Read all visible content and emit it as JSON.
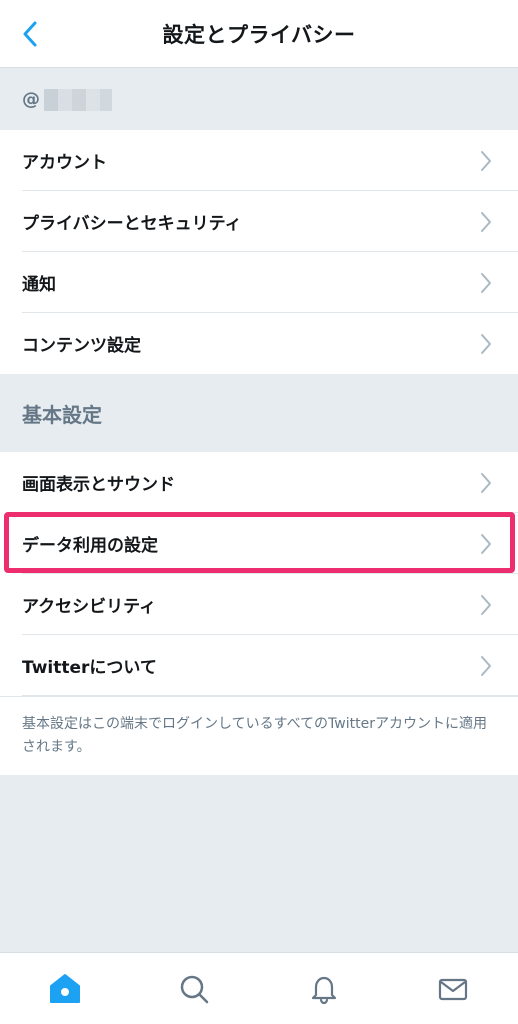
{
  "header": {
    "title": "設定とプライバシー",
    "back_icon": "back-chevron-icon"
  },
  "account": {
    "handle_prefix": "@"
  },
  "accent_color": "#1da1f2",
  "highlight_color": "#ec2e6e",
  "account_items": [
    {
      "label": "アカウント"
    },
    {
      "label": "プライバシーとセキュリティ"
    },
    {
      "label": "通知"
    },
    {
      "label": "コンテンツ設定"
    }
  ],
  "general": {
    "title": "基本設定",
    "items": [
      {
        "label": "画面表示とサウンド"
      },
      {
        "label": "データ利用の設定"
      },
      {
        "label": "アクセシビリティ"
      },
      {
        "label": "Twitterについて"
      }
    ],
    "note": "基本設定はこの端末でログインしているすべてのTwitterアカウントに適用されます。"
  },
  "tabbar": {
    "items": [
      {
        "icon": "home-icon",
        "active": true
      },
      {
        "icon": "search-icon",
        "active": false
      },
      {
        "icon": "bell-icon",
        "active": false
      },
      {
        "icon": "mail-icon",
        "active": false
      }
    ]
  }
}
